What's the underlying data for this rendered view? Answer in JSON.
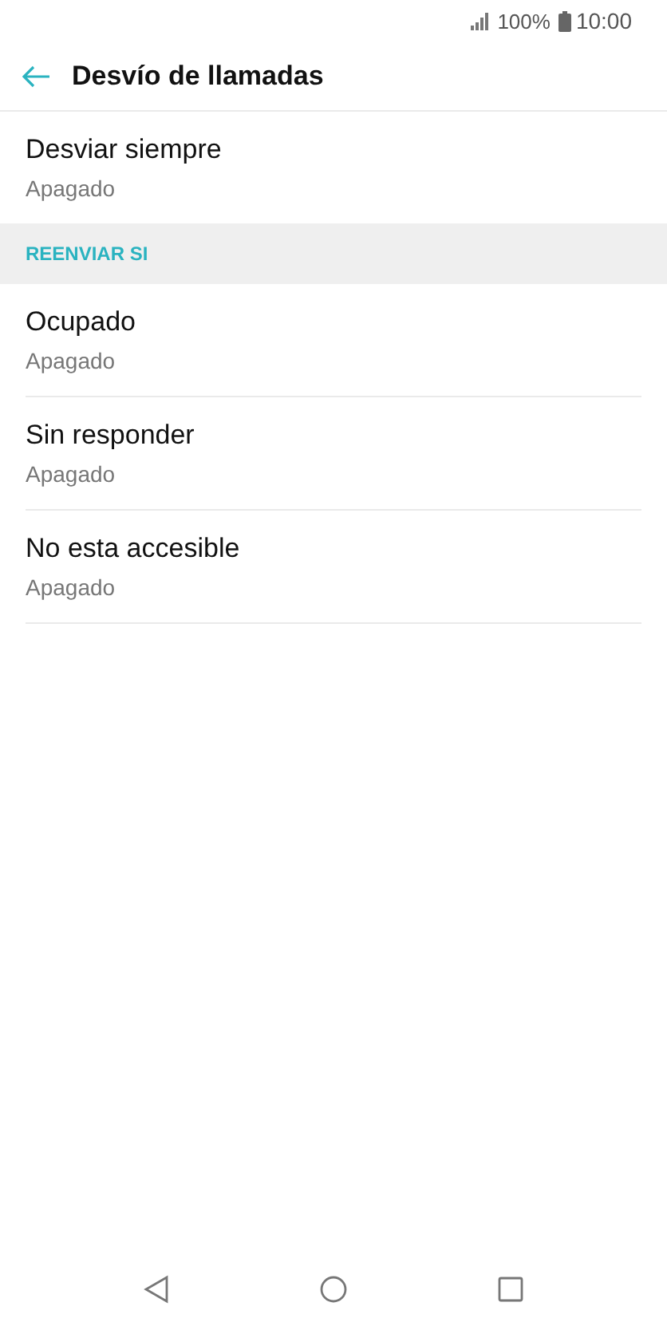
{
  "status_bar": {
    "battery": "100%",
    "time": "10:00"
  },
  "app_bar": {
    "title": "Desvío de llamadas"
  },
  "sections": [
    {
      "items": [
        {
          "title": "Desviar siempre",
          "subtitle": "Apagado"
        }
      ]
    },
    {
      "header": "REENVIAR SI",
      "items": [
        {
          "title": "Ocupado",
          "subtitle": "Apagado"
        },
        {
          "title": "Sin responder",
          "subtitle": "Apagado"
        },
        {
          "title": "No esta accesible",
          "subtitle": "Apagado"
        }
      ]
    }
  ]
}
